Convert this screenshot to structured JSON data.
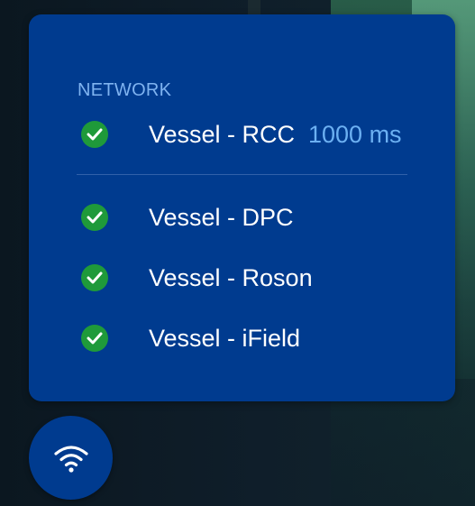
{
  "network_panel": {
    "title": "NETWORK",
    "connections": [
      {
        "label": "Vessel - RCC",
        "latency": "1000 ms",
        "status": "connected"
      },
      {
        "label": "Vessel - DPC",
        "status": "connected"
      },
      {
        "label": "Vessel - Roson",
        "status": "connected"
      },
      {
        "label": "Vessel - iField",
        "status": "connected"
      }
    ]
  },
  "wifi_button": {
    "icon": "wifi-icon"
  },
  "colors": {
    "panel_bg": "#003b8f",
    "title": "#7fb3f0",
    "check_bg": "#1f9a3a",
    "latency": "#6cb0f2"
  }
}
